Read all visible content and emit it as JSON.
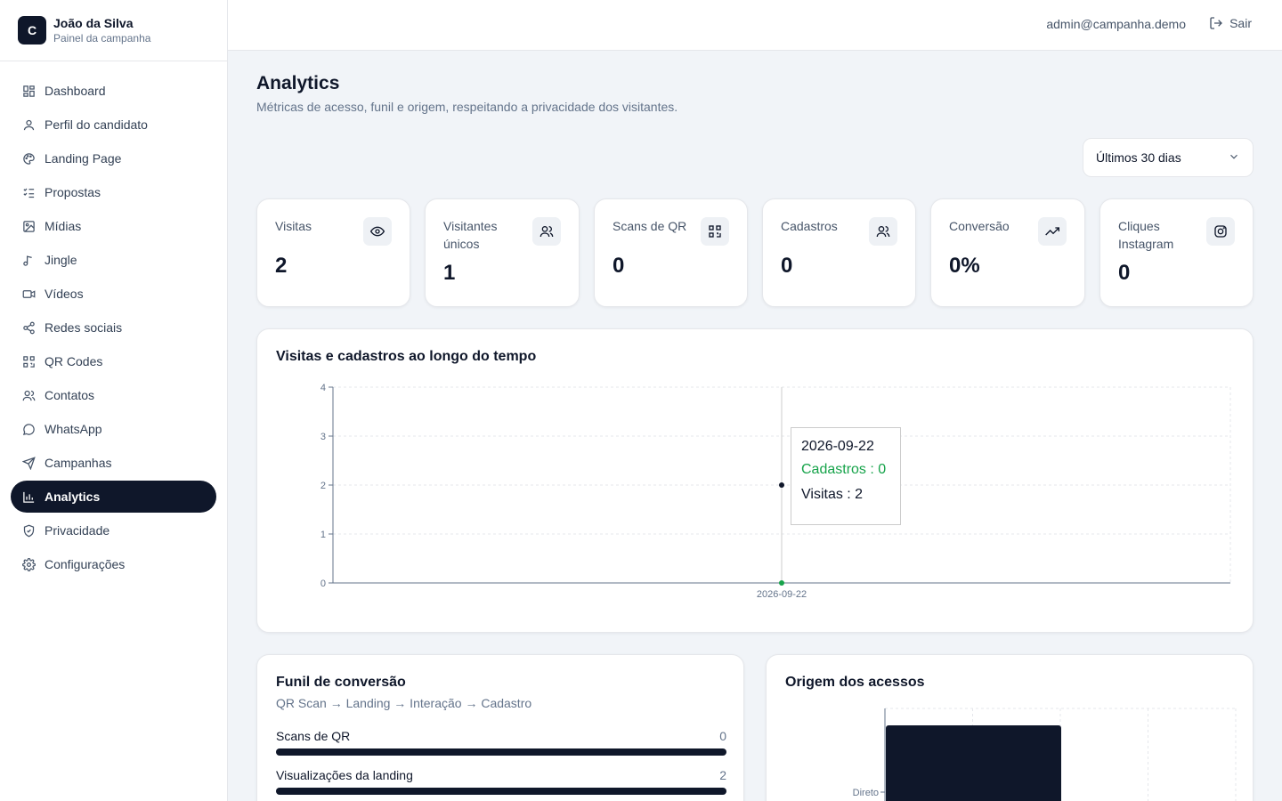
{
  "brand": {
    "initial": "C",
    "name": "João da Silva",
    "subtitle": "Painel da campanha"
  },
  "sidebar": {
    "items": [
      {
        "label": "Dashboard",
        "icon": "dashboard-icon"
      },
      {
        "label": "Perfil do candidato",
        "icon": "user-icon"
      },
      {
        "label": "Landing Page",
        "icon": "palette-icon"
      },
      {
        "label": "Propostas",
        "icon": "list-checks-icon"
      },
      {
        "label": "Mídias",
        "icon": "image-icon"
      },
      {
        "label": "Jingle",
        "icon": "music-icon"
      },
      {
        "label": "Vídeos",
        "icon": "video-icon"
      },
      {
        "label": "Redes sociais",
        "icon": "share-icon"
      },
      {
        "label": "QR Codes",
        "icon": "qr-code-icon"
      },
      {
        "label": "Contatos",
        "icon": "users-icon"
      },
      {
        "label": "WhatsApp",
        "icon": "message-circle-icon"
      },
      {
        "label": "Campanhas",
        "icon": "send-icon"
      },
      {
        "label": "Analytics",
        "icon": "bar-chart-icon",
        "active": true
      },
      {
        "label": "Privacidade",
        "icon": "shield-icon"
      },
      {
        "label": "Configurações",
        "icon": "settings-icon"
      }
    ]
  },
  "topbar": {
    "email": "admin@campanha.demo",
    "logout_label": "Sair"
  },
  "page": {
    "title": "Analytics",
    "subtitle": "Métricas de acesso, funil e origem, respeitando a privacidade dos visitantes."
  },
  "range_select": {
    "value": "Últimos 30 dias"
  },
  "stats": [
    {
      "label": "Visitas",
      "value": "2",
      "icon": "eye-icon"
    },
    {
      "label": "Visitantes únicos",
      "value": "1",
      "icon": "users-icon"
    },
    {
      "label": "Scans de QR",
      "value": "0",
      "icon": "qr-code-icon"
    },
    {
      "label": "Cadastros",
      "value": "0",
      "icon": "users-icon"
    },
    {
      "label": "Conversão",
      "value": "0%",
      "icon": "trending-up-icon"
    },
    {
      "label": "Cliques Instagram",
      "value": "0",
      "icon": "instagram-icon"
    }
  ],
  "timeline": {
    "title": "Visitas e cadastros ao longo do tempo",
    "tooltip": {
      "date": "2026-09-22",
      "cadastros": "Cadastros : 0",
      "visitas": "Visitas : 2"
    }
  },
  "funnel": {
    "title": "Funil de conversão",
    "subtitle": "QR Scan → Landing → Interação → Cadastro",
    "steps": [
      {
        "label": "Scans de QR",
        "value": "0"
      },
      {
        "label": "Visualizações da landing",
        "value": "2"
      }
    ]
  },
  "origin": {
    "title": "Origem dos acessos"
  },
  "colors": {
    "primary": "#0f172a",
    "cadastros": "#16a34a",
    "visitas": "#0f172a"
  },
  "chart_data": [
    {
      "type": "line",
      "x": [
        "2026-09-22"
      ],
      "series": [
        {
          "name": "Visitas",
          "values": [
            2
          ]
        },
        {
          "name": "Cadastros",
          "values": [
            0
          ]
        }
      ],
      "ylim": [
        0,
        4
      ],
      "yticks": [
        0,
        1,
        2,
        3,
        4
      ],
      "grid": true
    },
    {
      "type": "bar",
      "orientation": "horizontal",
      "categories": [
        "Direto"
      ],
      "values": [
        2
      ],
      "grid": true
    }
  ]
}
